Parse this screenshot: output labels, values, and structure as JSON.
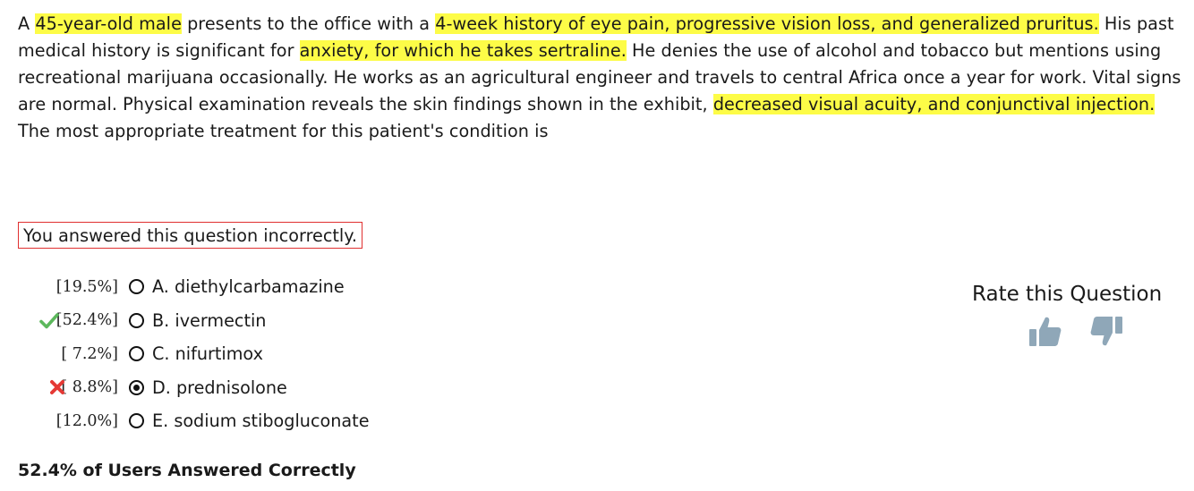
{
  "stem": {
    "segments": [
      {
        "text": "A ",
        "highlight": false
      },
      {
        "text": "45-year-old male",
        "highlight": true
      },
      {
        "text": " presents to the office with a ",
        "highlight": false
      },
      {
        "text": "4-week history of eye pain, progressive vision loss, and generalized pruritus.",
        "highlight": true
      },
      {
        "text": " His past medical history is significant for ",
        "highlight": false
      },
      {
        "text": "anxiety, for which he takes sertraline.",
        "highlight": true
      },
      {
        "text": " He denies the use of alcohol and tobacco but mentions using recreational marijuana occasionally. He works as an agricultural engineer and travels to central Africa once a year for work. Vital signs are normal. Physical examination reveals the skin findings shown in the exhibit, ",
        "highlight": false
      },
      {
        "text": "decreased visual acuity, and conjunctival injection.",
        "highlight": true
      },
      {
        "text": " The most appropriate treatment for this patient's condition is",
        "highlight": false
      }
    ]
  },
  "result": {
    "message": "You answered this question incorrectly."
  },
  "choices": [
    {
      "percent": "[19.5%]",
      "label": "A. diethylcarbamazine",
      "selected": false,
      "mark": "none"
    },
    {
      "percent": "[52.4%]",
      "label": "B. ivermectin",
      "selected": false,
      "mark": "correct"
    },
    {
      "percent": "[ 7.2%]",
      "label": "C. nifurtimox",
      "selected": false,
      "mark": "none"
    },
    {
      "percent": "[ 8.8%]",
      "label": "D. prednisolone",
      "selected": true,
      "mark": "incorrect"
    },
    {
      "percent": "[12.0%]",
      "label": "E. sodium stibogluconate",
      "selected": false,
      "mark": "none"
    }
  ],
  "stats": {
    "correct_summary": "52.4% of Users Answered Correctly"
  },
  "rating": {
    "title": "Rate this Question",
    "up_icon": "thumbs-up-icon",
    "down_icon": "thumbs-down-icon"
  },
  "colors": {
    "highlight": "#fdfc47",
    "correct": "#5cb85c",
    "incorrect": "#e53935",
    "error_border": "#e03030",
    "thumb": "#8fa7b8"
  }
}
